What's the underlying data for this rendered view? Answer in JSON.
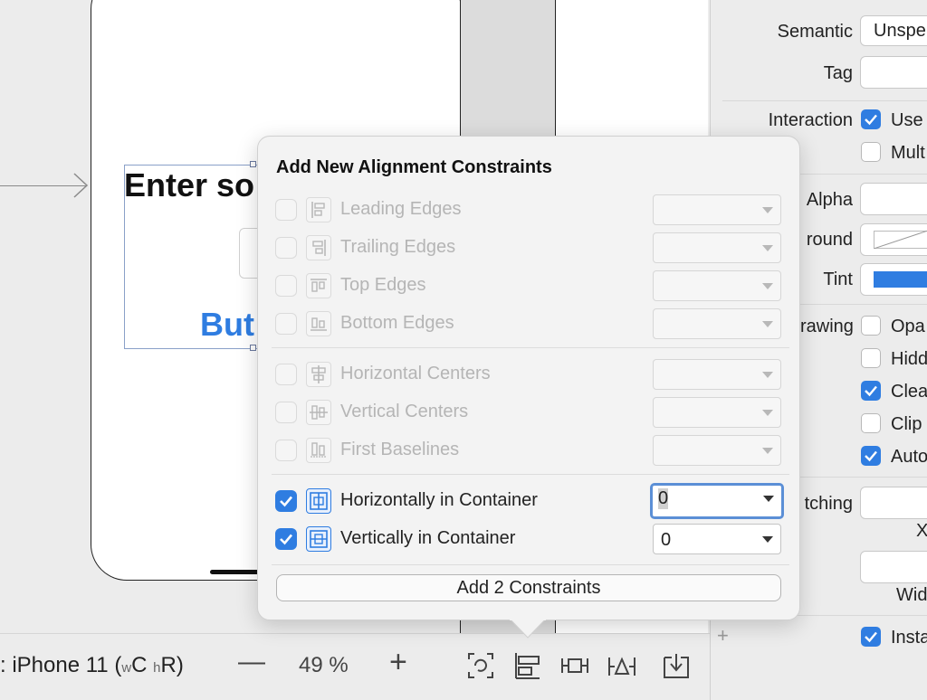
{
  "canvas": {
    "label_text": "Enter so",
    "button_text": "But"
  },
  "toolbar": {
    "device_prefix": ": iPhone 11 (",
    "size_w": "w",
    "size_c": "C",
    "size_h": "h",
    "size_r": "R)",
    "zoom_minus": "—",
    "zoom_value": "49 %",
    "zoom_plus": "+",
    "icons": [
      "refresh-constraints-icon",
      "align-icon",
      "pin-icon",
      "resolve-icon",
      "embed-icon"
    ]
  },
  "inspector": {
    "semantic_label": "Semantic",
    "semantic_value": "Unspe",
    "tag_label": "Tag",
    "interaction_label": "Interaction",
    "user_interaction": "Use",
    "multiple_touch": "Mult",
    "alpha_label": "Alpha",
    "background_label": "round",
    "tint_label": "Tint",
    "tint_color": "#2f7de1",
    "drawing_label": "rawing",
    "opaque": "Opa",
    "hidden": "Hidd",
    "clears": "Clea",
    "clip": "Clip",
    "autoresize": "Auto",
    "stretching_label": "tching",
    "x_label": "X",
    "width_label": "Wid",
    "installed": "Insta",
    "plus": "+"
  },
  "popover": {
    "title": "Add New Alignment Constraints",
    "rows": [
      {
        "label": "Leading Edges",
        "checked": false,
        "enabled": false,
        "value": ""
      },
      {
        "label": "Trailing Edges",
        "checked": false,
        "enabled": false,
        "value": ""
      },
      {
        "label": "Top Edges",
        "checked": false,
        "enabled": false,
        "value": ""
      },
      {
        "label": "Bottom Edges",
        "checked": false,
        "enabled": false,
        "value": ""
      },
      {
        "label": "Horizontal Centers",
        "checked": false,
        "enabled": false,
        "value": ""
      },
      {
        "label": "Vertical Centers",
        "checked": false,
        "enabled": false,
        "value": ""
      },
      {
        "label": "First Baselines",
        "checked": false,
        "enabled": false,
        "value": ""
      },
      {
        "label": "Horizontally in Container",
        "checked": true,
        "enabled": true,
        "value": "0"
      },
      {
        "label": "Vertically in Container",
        "checked": true,
        "enabled": true,
        "value": "0"
      }
    ],
    "add_button": "Add 2 Constraints"
  },
  "colors": {
    "accent": "#2f7de1",
    "button_text": "#2f7de1"
  }
}
